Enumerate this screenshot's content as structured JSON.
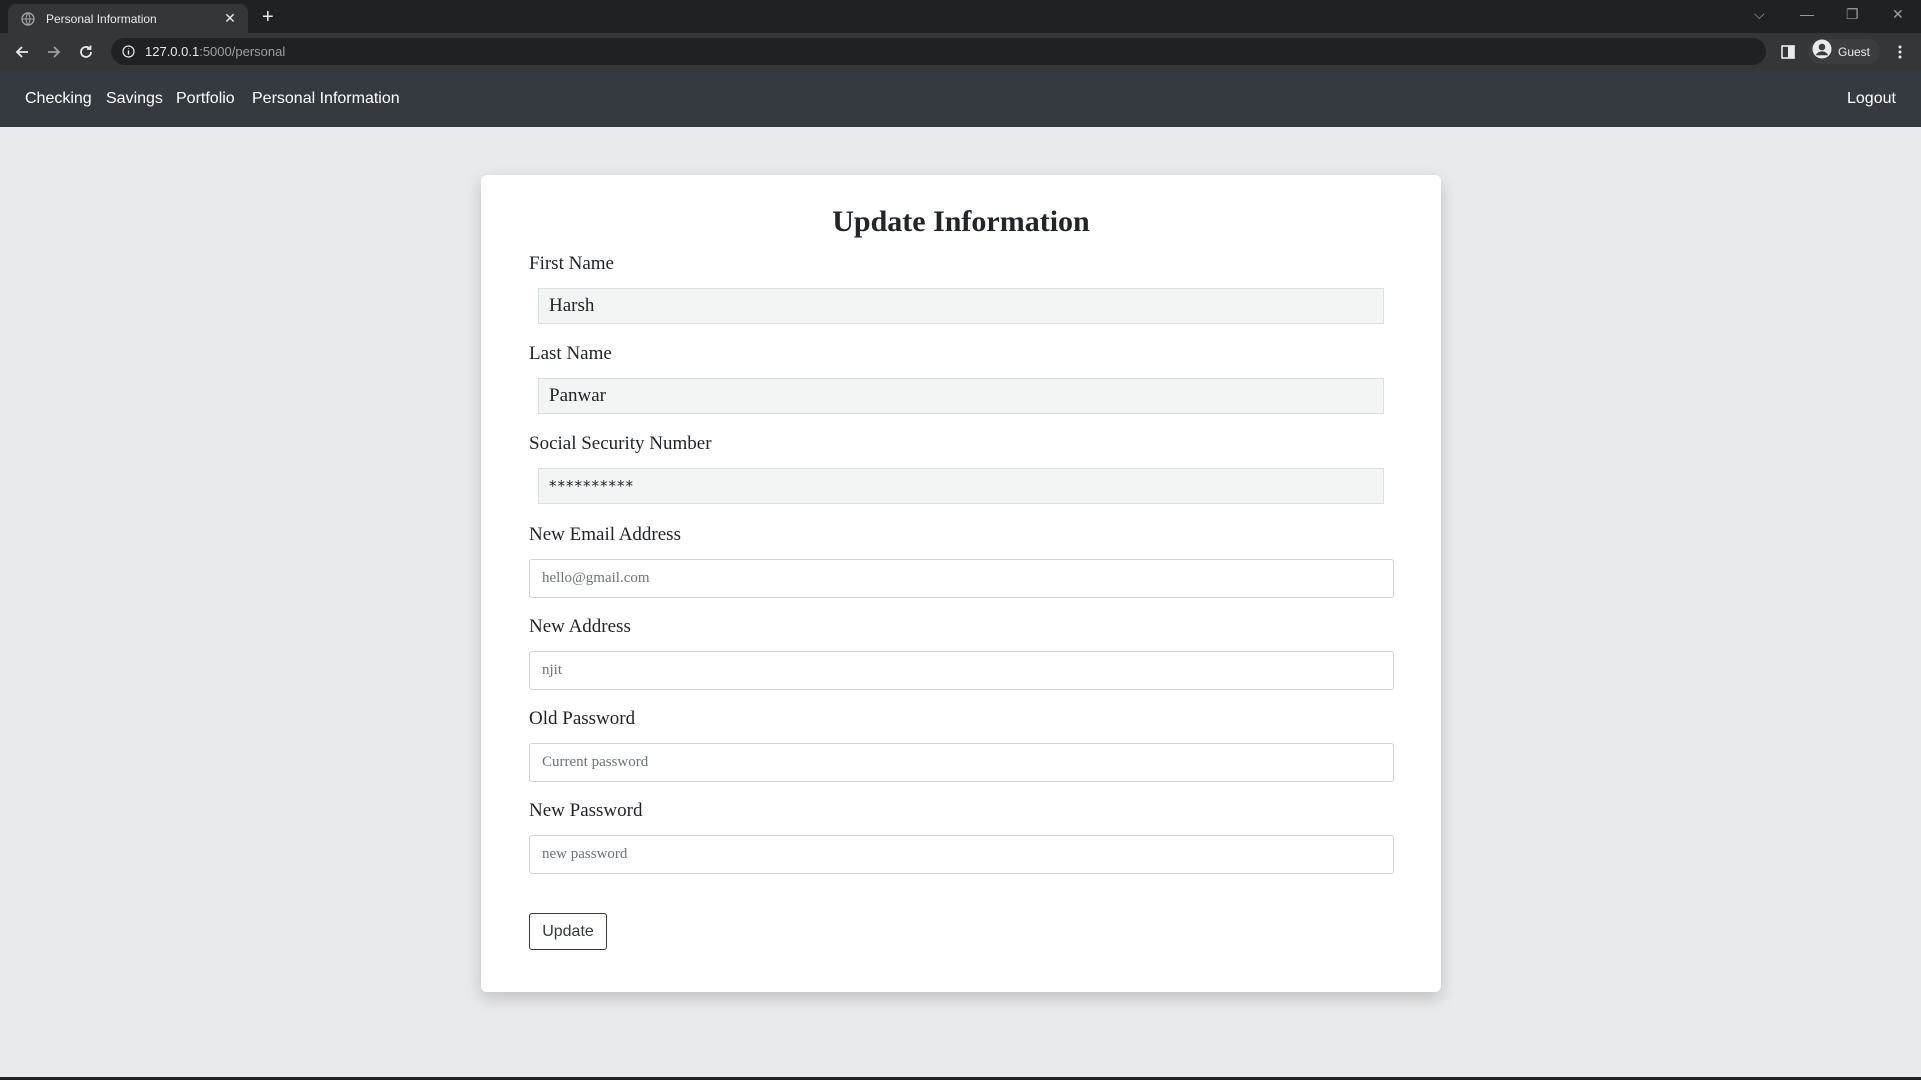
{
  "browser": {
    "tab_title": "Personal Information",
    "url_host": "127.0.0.1",
    "url_path": ":5000/personal",
    "profile_label": "Guest"
  },
  "navbar": {
    "links": [
      "Checking",
      "Savings",
      "Portfolio",
      "Personal Information"
    ],
    "logout": "Logout",
    "background": "#343a40"
  },
  "form": {
    "title": "Update Information",
    "first_name": {
      "label": "First Name",
      "value": "Harsh"
    },
    "last_name": {
      "label": "Last Name",
      "value": "Panwar"
    },
    "ssn": {
      "label": "Social Security Number",
      "value": "**********"
    },
    "email": {
      "label": "New Email Address",
      "placeholder": "hello@gmail.com"
    },
    "address": {
      "label": "New Address",
      "placeholder": "njit"
    },
    "old_password": {
      "label": "Old Password",
      "placeholder": "Current password"
    },
    "new_password": {
      "label": "New Password",
      "placeholder": "new password"
    },
    "submit_label": "Update"
  }
}
